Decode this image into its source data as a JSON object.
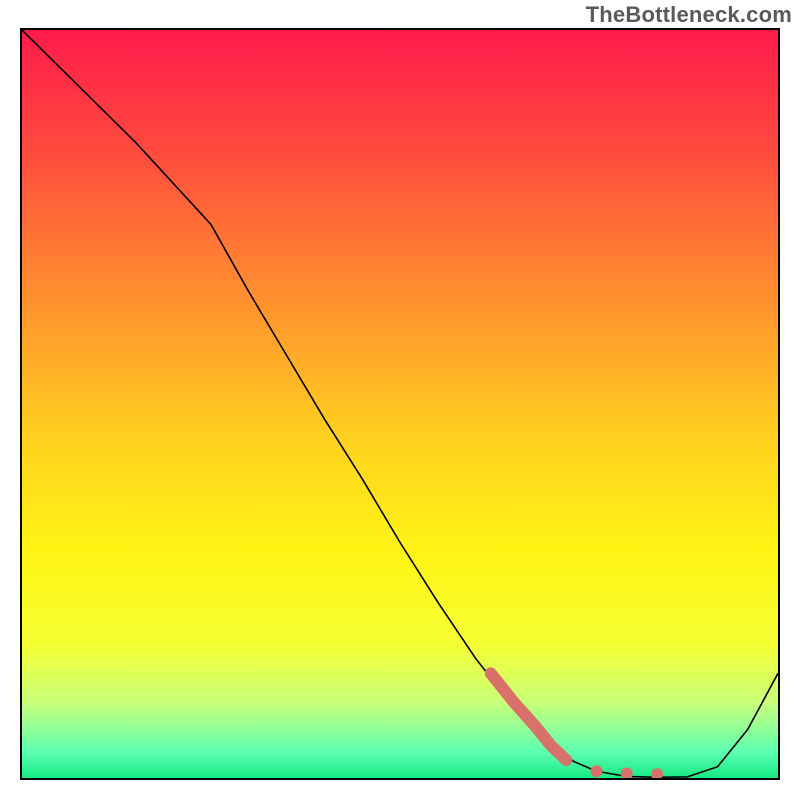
{
  "watermark": "TheBottleneck.com",
  "chart_data": {
    "type": "line",
    "title": "",
    "xlabel": "",
    "ylabel": "",
    "xlim": [
      0,
      100
    ],
    "ylim": [
      0,
      100
    ],
    "background": {
      "gradient_stops": [
        {
          "offset": 0.0,
          "color": "#ff1b4b"
        },
        {
          "offset": 0.15,
          "color": "#ff473e"
        },
        {
          "offset": 0.35,
          "color": "#ff8d2f"
        },
        {
          "offset": 0.55,
          "color": "#ffd21f"
        },
        {
          "offset": 0.7,
          "color": "#fff514"
        },
        {
          "offset": 0.82,
          "color": "#f5ff33"
        },
        {
          "offset": 0.9,
          "color": "#c8ff7a"
        },
        {
          "offset": 0.965,
          "color": "#5dffb1"
        },
        {
          "offset": 1.0,
          "color": "#17e884"
        }
      ]
    },
    "series": [
      {
        "name": "curve",
        "color": "#000000",
        "width": 1.6,
        "x": [
          0,
          5,
          10,
          15,
          20,
          25,
          30,
          35,
          40,
          45,
          50,
          55,
          60,
          65,
          70,
          73,
          76,
          80,
          84,
          88,
          92,
          96,
          100
        ],
        "y": [
          100,
          95,
          90,
          85,
          79.5,
          74,
          65,
          56.5,
          48,
          40,
          31.5,
          23.5,
          16,
          9.5,
          4.5,
          2.2,
          0.9,
          0.2,
          0.1,
          0.15,
          1.5,
          6.5,
          14
        ]
      },
      {
        "name": "highlight",
        "color": "#d9716b",
        "width": 12,
        "linecap": "round",
        "x": [
          62,
          65,
          68,
          70,
          72
        ],
        "y": [
          14,
          10.2,
          6.8,
          4.3,
          2.4
        ]
      }
    ],
    "points": [
      {
        "name": "dot-1",
        "x": 76,
        "y": 0.9,
        "r": 6,
        "color": "#d9716b"
      },
      {
        "name": "dot-2",
        "x": 80,
        "y": 0.6,
        "r": 6,
        "color": "#d9716b"
      },
      {
        "name": "dot-3",
        "x": 84,
        "y": 0.5,
        "r": 6,
        "color": "#d9716b"
      }
    ]
  }
}
